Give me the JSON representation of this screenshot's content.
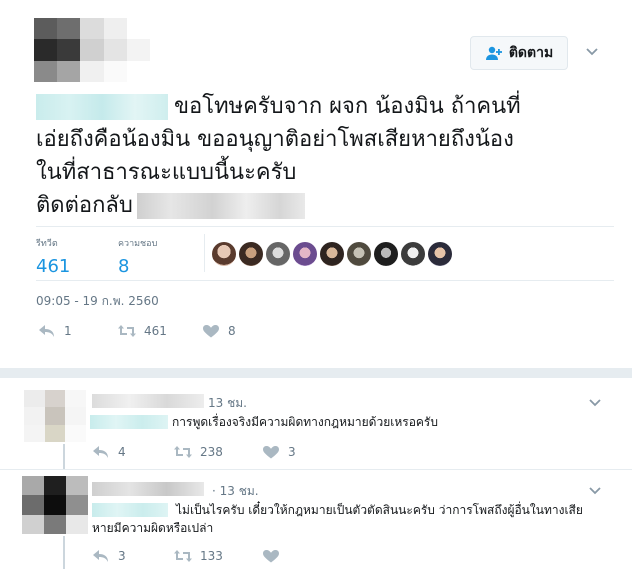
{
  "main_tweet": {
    "follow_button": {
      "label": "ติดตาม",
      "icon": "add-user-icon"
    },
    "text": {
      "line1": "ขอโทษครับจาก ผจก น้องมิน ถ้าคนที่",
      "line2": "เอ่ยถึงคือน้องมิน ขออนุญาติอย่าโพสเสียหายถึงน้อง",
      "line3": "ในที่สาธารณะแบบนี้นะครับ",
      "line4": "ติดต่อกลับ"
    },
    "stats": {
      "retweets_label": "รีทวีต",
      "retweets_value": "461",
      "likes_label": "ความชอบ",
      "likes_value": "8"
    },
    "timestamp": "09:05 - 19 ก.พ. 2560",
    "actions": {
      "replies": "1",
      "retweets": "461",
      "likes": "8"
    }
  },
  "replies": [
    {
      "time": "13 ชม.",
      "text": "การพูดเรื่องจริงมีความผิดทางกฎหมายด้วยเหรอครับ",
      "actions": {
        "replies": "4",
        "retweets": "238",
        "likes": "3"
      }
    },
    {
      "time": "· 13 ชม.",
      "text": "ไม่เป็นไรครับ เดี๋ยวให้กฎหมายเป็นตัวตัดสินนะครับ ว่าการโพสถึงผู้อื่นในทางเสียหายมีความผิดหรือเปล่า",
      "actions": {
        "replies": "3",
        "retweets": "133",
        "likes": ""
      }
    }
  ],
  "colors": {
    "accent": "#1b95e0",
    "muted": "#657786",
    "divider": "#e6ecf0",
    "text": "#14171a"
  }
}
